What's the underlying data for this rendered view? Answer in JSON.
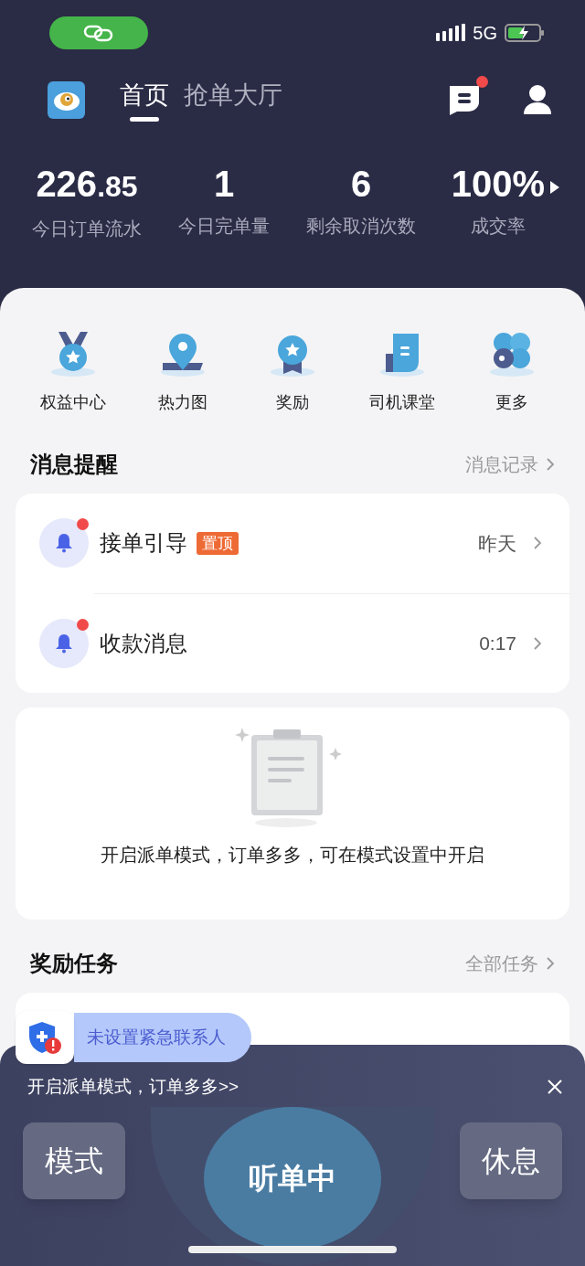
{
  "status_bar": {
    "network": "5G"
  },
  "nav": {
    "tabs": [
      {
        "label": "首页",
        "selected": true
      },
      {
        "label": "抢单大厅",
        "selected": false
      }
    ],
    "messages_unread": true
  },
  "stats": [
    {
      "value": "226",
      "decimal": ".85",
      "label": "今日订单流水"
    },
    {
      "value": "1",
      "label": "今日完单量"
    },
    {
      "value": "6",
      "label": "剩余取消次数"
    },
    {
      "value": "100%",
      "label": "成交率"
    }
  ],
  "shortcuts": [
    {
      "kind": "medal",
      "label": "权益中心"
    },
    {
      "kind": "pin",
      "label": "热力图"
    },
    {
      "kind": "award",
      "label": "奖励"
    },
    {
      "kind": "book",
      "label": "司机课堂"
    },
    {
      "kind": "more",
      "label": "更多"
    }
  ],
  "messages": {
    "title": "消息提醒",
    "link": "消息记录",
    "items": [
      {
        "title": "接单引导",
        "tag": "置顶",
        "time": "昨天",
        "unread": true
      },
      {
        "title": "收款消息",
        "time": "0:17",
        "unread": true
      }
    ]
  },
  "empty_state": {
    "text": "开启派单模式，订单多多，可在模式设置中开启"
  },
  "rewards": {
    "title": "奖励任务",
    "link": "全部任务"
  },
  "toast": {
    "text": "未设置紧急联系人"
  },
  "bottom_panel": {
    "promo": "开启派单模式，订单多多>>",
    "buttons": [
      {
        "kind": "side",
        "label": "模式"
      },
      {
        "kind": "main",
        "label": "听单中"
      },
      {
        "kind": "side",
        "label": "休息"
      }
    ]
  }
}
